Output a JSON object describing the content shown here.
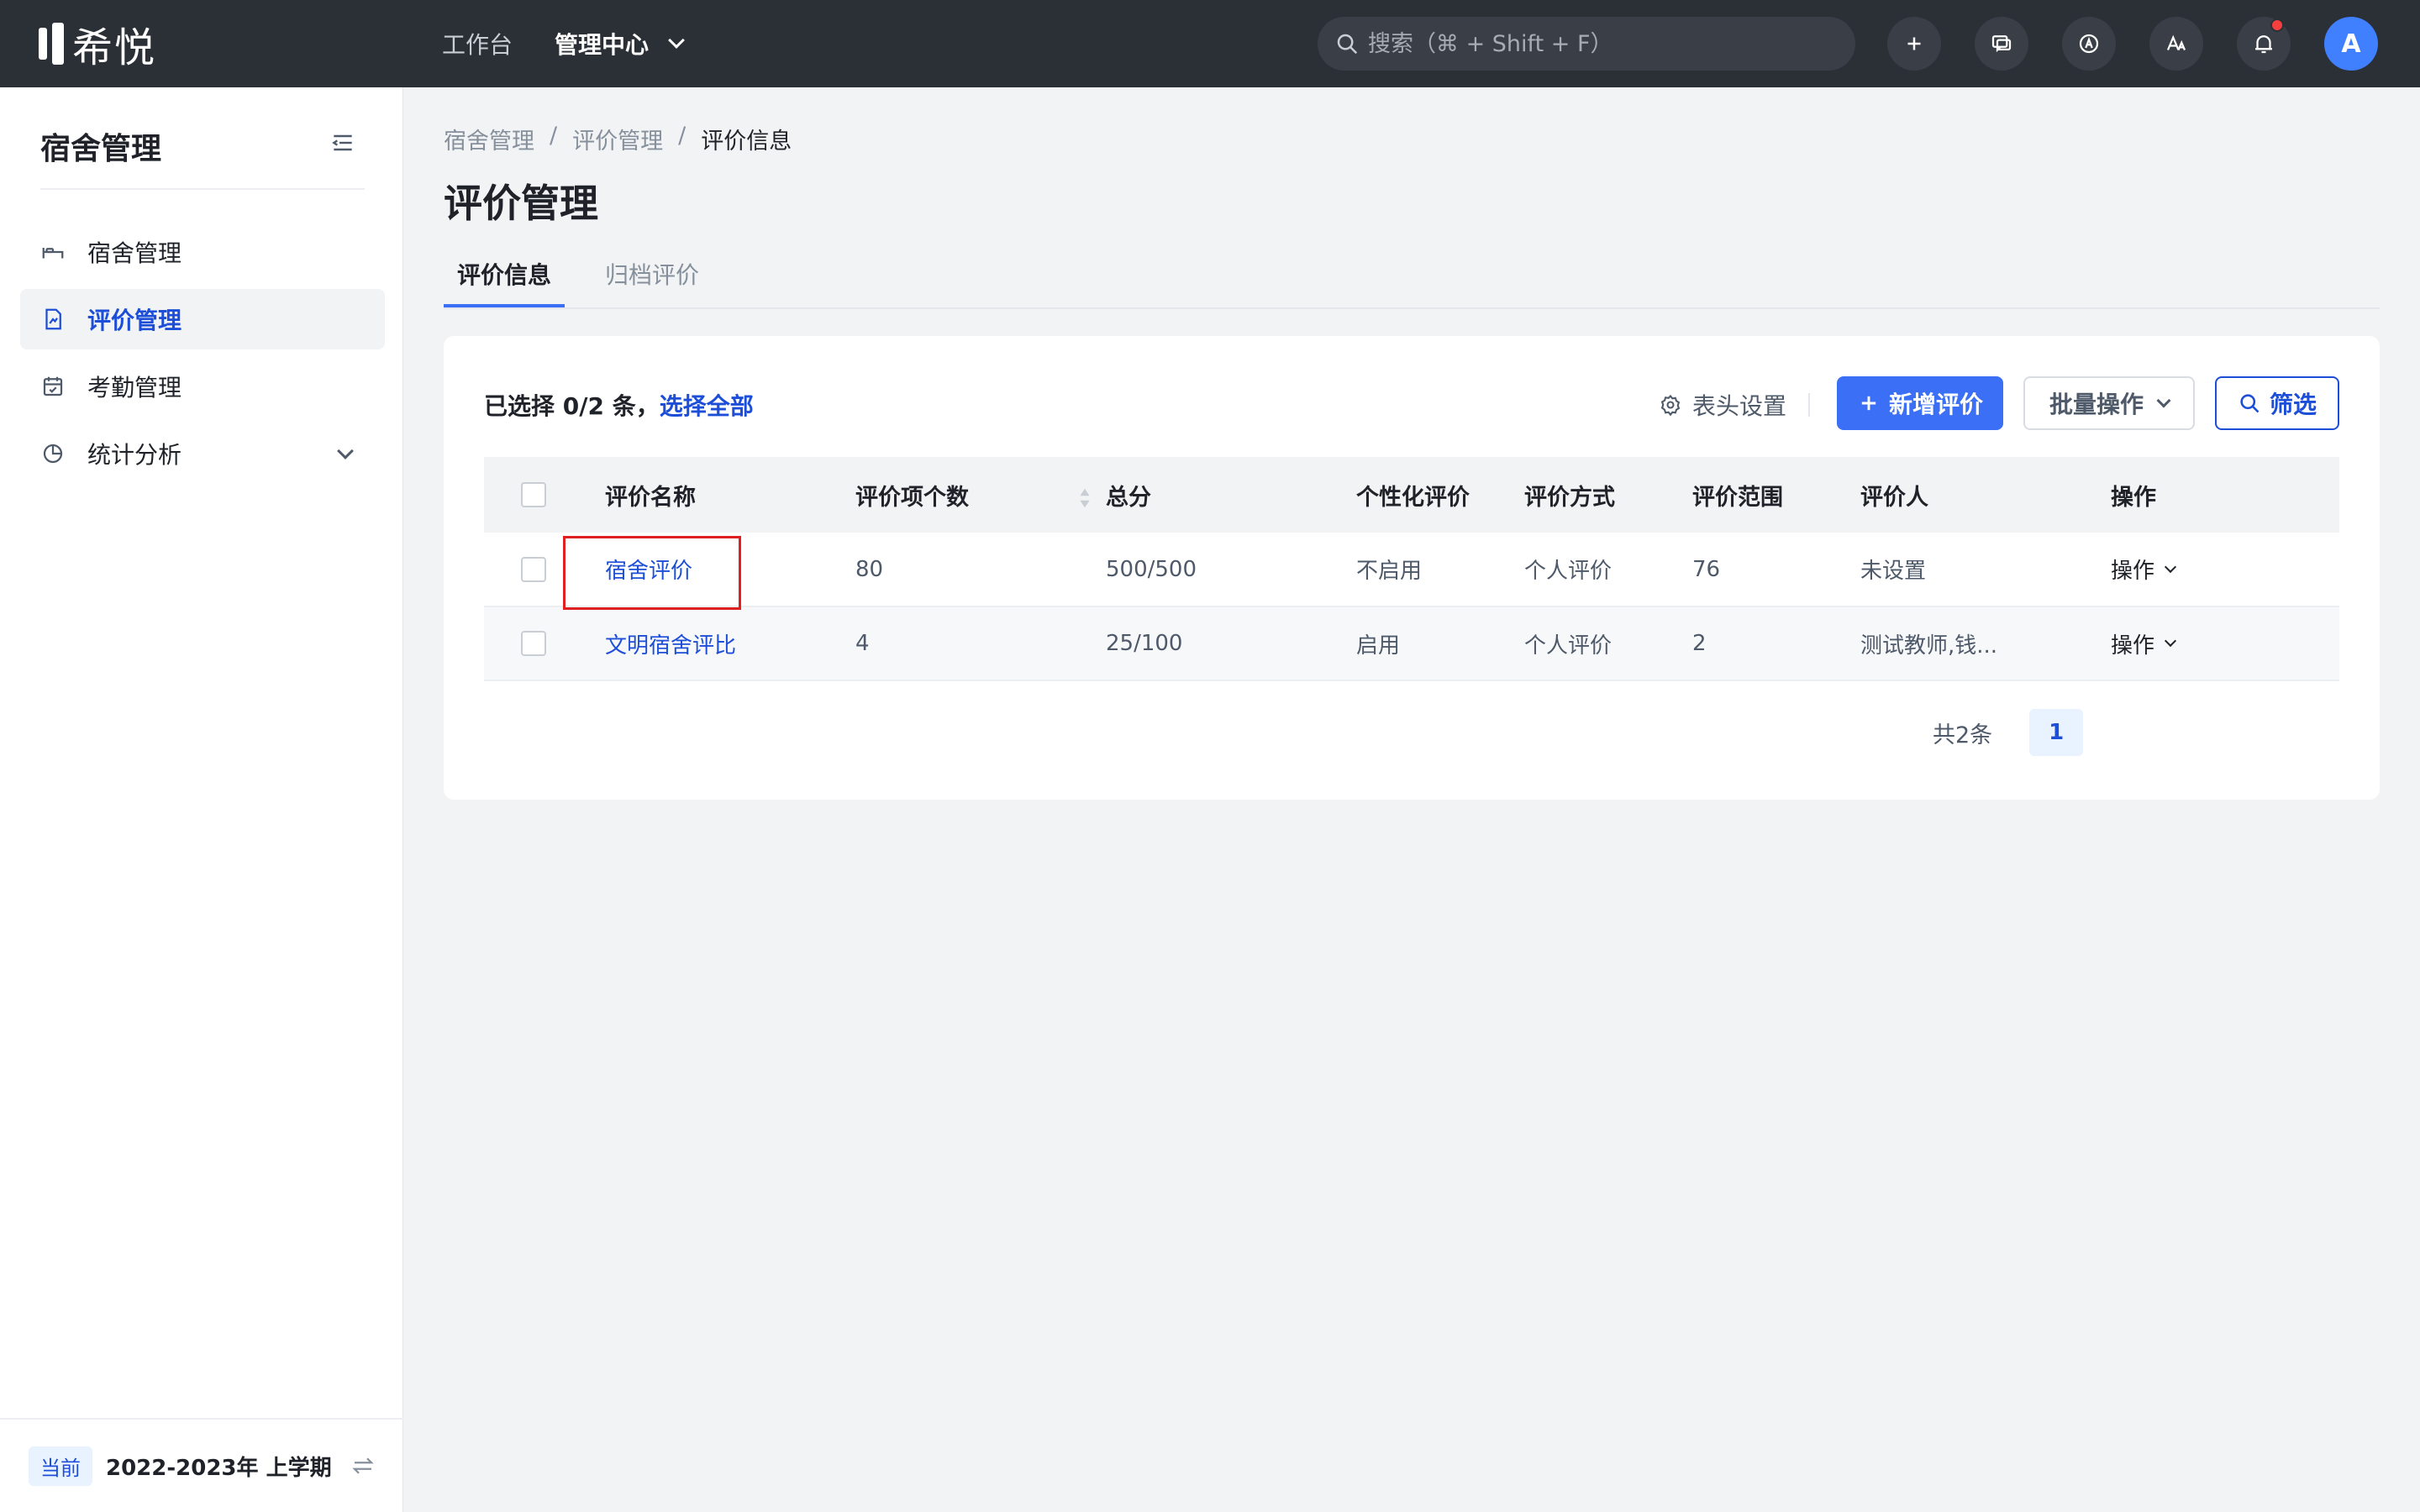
{
  "app": {
    "logo_text": "希悦"
  },
  "topnav": {
    "items": [
      {
        "label": "工作台",
        "active": false
      },
      {
        "label": "管理中心",
        "active": true
      }
    ]
  },
  "search": {
    "placeholder": "搜索（⌘ + Shift + F）"
  },
  "toolbar_icons": [
    "plus-icon",
    "message-icon",
    "app-icon",
    "translate-icon",
    "bell-icon"
  ],
  "avatar": {
    "initial": "A",
    "color": "#4080ff"
  },
  "sidebar": {
    "title": "宿舍管理",
    "items": [
      {
        "label": "宿舍管理",
        "icon": "bed-icon",
        "active": false
      },
      {
        "label": "评价管理",
        "icon": "document-chart-icon",
        "active": true
      },
      {
        "label": "考勤管理",
        "icon": "calendar-check-icon",
        "active": false
      },
      {
        "label": "统计分析",
        "icon": "pie-chart-icon",
        "active": false,
        "expandable": true
      }
    ],
    "footer": {
      "badge": "当前",
      "term": "2022-2023年 上学期"
    }
  },
  "breadcrumb": [
    "宿舍管理",
    "评价管理",
    "评价信息"
  ],
  "breadcrumb_separator": "/",
  "page_title": "评价管理",
  "tabs": [
    {
      "label": "评价信息",
      "active": true
    },
    {
      "label": "归档评价",
      "active": false
    }
  ],
  "card": {
    "selection_prefix": "已选择 0/2 条，",
    "select_all": "选择全部",
    "header_settings": "表头设置",
    "add_button": "新增评价",
    "batch_button": "批量操作",
    "filter_button": "筛选"
  },
  "table": {
    "columns": [
      "评价名称",
      "评价项个数",
      "总分",
      "个性化评价",
      "评价方式",
      "评价范围",
      "评价人",
      "操作"
    ],
    "rows": [
      {
        "name": "宿舍评价",
        "items": "80",
        "score": "500/500",
        "personalized": "不启用",
        "method": "个人评价",
        "scope": "76",
        "evaluator": "未设置",
        "action": "操作"
      },
      {
        "name": "文明宿舍评比",
        "items": "4",
        "score": "25/100",
        "personalized": "启用",
        "method": "个人评价",
        "scope": "2",
        "evaluator": "测试教师,钱...",
        "action": "操作"
      }
    ]
  },
  "pagination": {
    "total": "共2条",
    "current_page": "1"
  },
  "colors": {
    "primary": "#3b6ff5",
    "link": "#1d4ed8",
    "topbar": "#2b2f36",
    "highlight_box": "#e02020"
  }
}
